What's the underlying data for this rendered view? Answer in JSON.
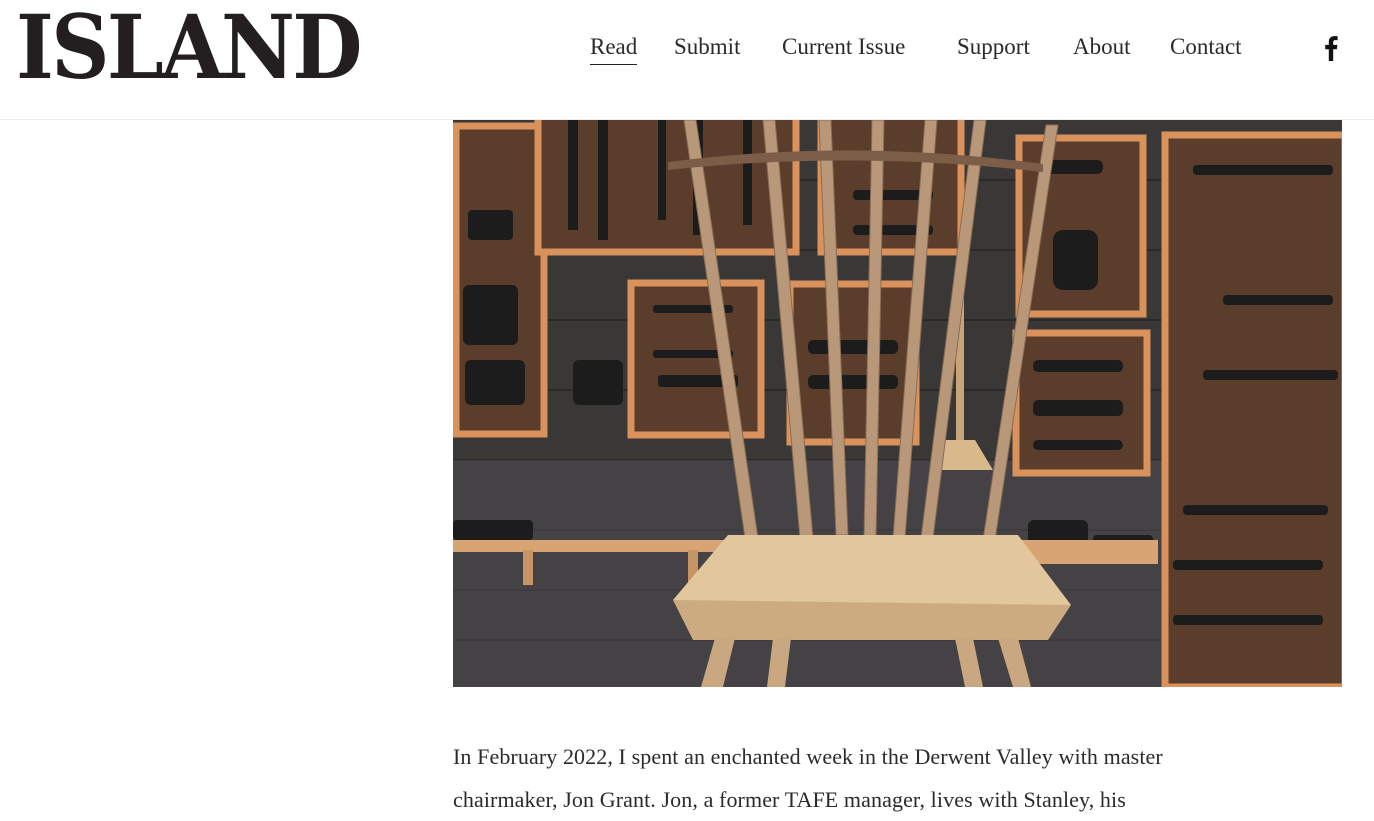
{
  "site": {
    "logo": "ISLAND"
  },
  "nav": {
    "items": [
      {
        "label": "Read",
        "active": true
      },
      {
        "label": "Submit",
        "active": false
      },
      {
        "label": "Current Issue",
        "active": false
      },
      {
        "label": "Support",
        "active": false
      },
      {
        "label": "About",
        "active": false
      },
      {
        "label": "Contact",
        "active": false
      }
    ],
    "social_icon": "facebook-icon"
  },
  "hero_image": {
    "subject": "windsor-chair-in-woodworking-workshop"
  },
  "article": {
    "lines": [
      "In February 2022, I spent an enchanted week in the Derwent Valley with master",
      "chairmaker, Jon Grant. Jon, a former TAFE manager, lives with Stanley, his"
    ]
  },
  "colors": {
    "text": "#222222",
    "logo": "#231f20",
    "background": "#ffffff"
  }
}
